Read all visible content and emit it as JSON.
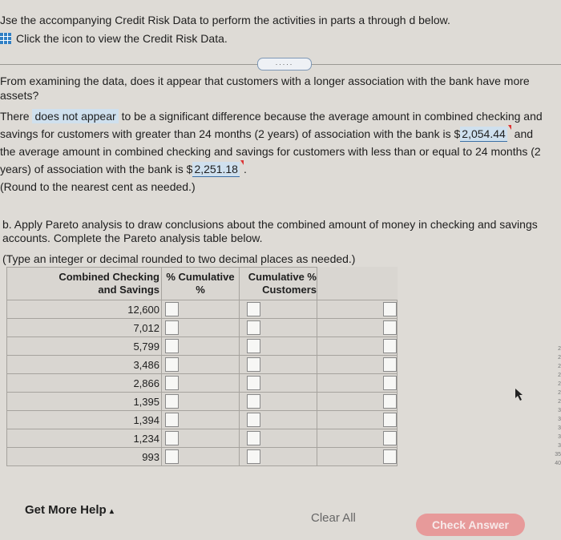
{
  "instructions": {
    "intro": "Jse the accompanying Credit Risk Data to perform the activities in parts a through d below.",
    "data_link": "Click the icon to view the Credit Risk Data."
  },
  "part_a": {
    "question_line1": "From examining the data, does it appear that customers with a longer association with the bank have more",
    "question_line2": "assets?",
    "answer_prefix": "There",
    "answer_choice": "does not appear",
    "answer_text1": "to be a significant difference because the average amount in combined checking and",
    "answer_text2": "savings for customers with greater than 24 months (2 years) of association with the bank is $",
    "value_over_24": "2,054.44",
    "answer_text2_end": "and",
    "answer_text3": "the average amount in combined checking and savings for customers with less than or equal to 24 months (2",
    "answer_text4": "years) of association with the bank is $",
    "value_under_24": "2,251.18",
    "round_note": "(Round to the nearest cent as needed.)"
  },
  "part_b": {
    "line1": "b. Apply Pareto analysis to draw conclusions about the combined amount of money in checking and savings",
    "line2": "accounts. Complete the Pareto analysis table below.",
    "type_note": "(Type an integer or decimal rounded to two decimal places as needed.)"
  },
  "table": {
    "col1_line1": "Combined Checking",
    "col1_line2": "and Savings",
    "col2": "% Cumulative %",
    "col3_line1": "Cumulative %",
    "col3_line2": "Customers",
    "rows": [
      "12,600",
      "7,012",
      "5,799",
      "3,486",
      "2,866",
      "1,395",
      "1,394",
      "1,234",
      "993"
    ]
  },
  "footer": {
    "help": "Get More Help",
    "help_caret": "▴",
    "clear": "Clear All",
    "check": "Check Answer"
  },
  "side_numbers": [
    "2",
    "2",
    "2",
    "2",
    "2",
    "2",
    "2",
    "3",
    "3",
    "3",
    "3",
    "3",
    "35",
    "40"
  ],
  "expand_dots": "....."
}
